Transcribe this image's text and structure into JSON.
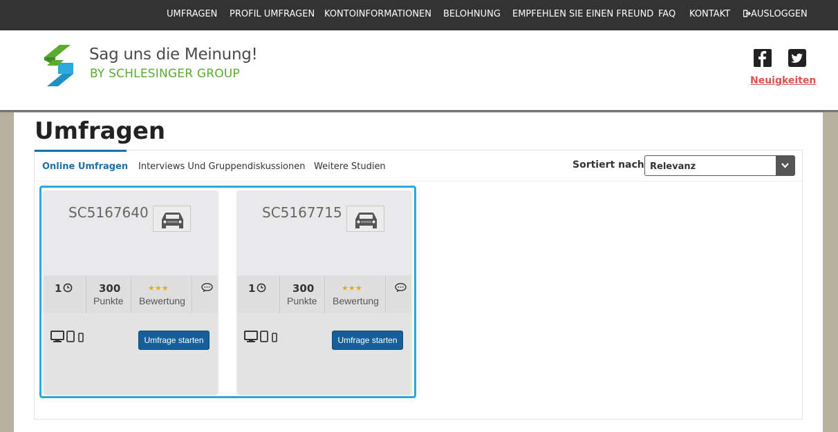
{
  "nav": {
    "items": [
      "UMFRAGEN",
      "PROFIL UMFRAGEN",
      "KONTOINFORMATIONEN",
      "BELOHNUNG",
      "EMPFEHLEN SIE EINEN FREUND",
      "FAQ",
      "KONTAKT"
    ],
    "logout_label": "AUSLOGGEN",
    "logout_icon": "logout-icon"
  },
  "header": {
    "brand_line1": "Sag uns die Meinung!",
    "brand_line2": "BY SCHLESINGER GROUP",
    "social_icons": [
      "facebook-icon",
      "twitter-icon"
    ],
    "news_link": "Neuigkeiten",
    "colors": {
      "brand_green": "#5aab2f",
      "brand_blue": "#2ea8dc",
      "news_red": "#d9534f"
    }
  },
  "main": {
    "title": "Umfragen",
    "tabs": [
      {
        "label": "Online Umfragen",
        "active": true
      },
      {
        "label": "Interviews Und Gruppendiskussionen",
        "active": false
      },
      {
        "label": "Weitere Studien",
        "active": false
      }
    ],
    "sort": {
      "label": "Sortiert nach:",
      "value": "Relevanz"
    }
  },
  "surveys": [
    {
      "code": "SC5167640",
      "icon": "car-icon",
      "duration": "1",
      "points": "300",
      "points_label": "Punkte",
      "rating_stars": "★★★",
      "rating_label": "Bewertung",
      "button": "Umfrage starten"
    },
    {
      "code": "SC5167715",
      "icon": "car-icon",
      "duration": "1",
      "points": "300",
      "points_label": "Punkte",
      "rating_stars": "★★★",
      "rating_label": "Bewertung",
      "button": "Umfrage starten"
    }
  ],
  "colors": {
    "accent": "#1a6fa8",
    "button": "#165f9a",
    "highlight": "#2ea8dc",
    "star": "#e8a81c"
  }
}
